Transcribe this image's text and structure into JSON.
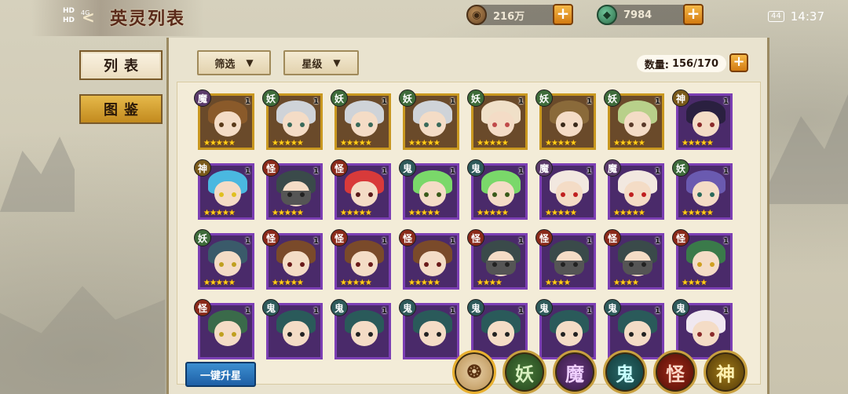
{
  "status_bar": {
    "left_labels": [
      "HD",
      "HD"
    ],
    "signal_text": "4G",
    "battery": "44",
    "time": "14:37"
  },
  "header": {
    "back_glyph": "<",
    "title": "英灵列表"
  },
  "resources": [
    {
      "name": "coin",
      "icon": "coin-icon",
      "value": "216万"
    },
    {
      "name": "jade",
      "icon": "jade-icon",
      "value": "7984"
    }
  ],
  "side_tabs": [
    {
      "label": "列表",
      "active": true
    },
    {
      "label": "图鉴",
      "active": false
    }
  ],
  "filters": [
    {
      "label": "筛选"
    },
    {
      "label": "星级"
    }
  ],
  "count": {
    "label": "数量:",
    "value": "156/170"
  },
  "plus_glyph": "+",
  "caret_glyph": "▼",
  "cards": [
    {
      "type": "魔",
      "level": "1",
      "frame": "gold",
      "stars": "★★★★★",
      "hair": "#8a5a2a",
      "eyes": "#5a3a1a"
    },
    {
      "type": "妖",
      "level": "1",
      "frame": "gold",
      "stars": "★★★★★",
      "hair": "#cfd3d8",
      "eyes": "#3a6a5a"
    },
    {
      "type": "妖",
      "level": "1",
      "frame": "gold",
      "stars": "★★★★★",
      "hair": "#cfd3d8",
      "eyes": "#3a6a5a"
    },
    {
      "type": "妖",
      "level": "1",
      "frame": "gold",
      "stars": "★★★★★",
      "hair": "#cfd3d8",
      "eyes": "#3a6a5a"
    },
    {
      "type": "妖",
      "level": "1",
      "frame": "gold",
      "stars": "★★★★★",
      "hair": "#f0e0c8",
      "eyes": "#c04a4a"
    },
    {
      "type": "妖",
      "level": "1",
      "frame": "gold",
      "stars": "★★★★★",
      "hair": "#8a6a3a",
      "eyes": "#3a2a1a"
    },
    {
      "type": "妖",
      "level": "1",
      "frame": "gold",
      "stars": "★★★★★",
      "hair": "#b8d08a",
      "eyes": "#5a3a2a"
    },
    {
      "type": "神",
      "level": "1",
      "frame": "purple",
      "stars": "★★★★★",
      "hair": "#2a2040",
      "eyes": "#8a2a2a"
    },
    {
      "type": "神",
      "level": "1",
      "frame": "purple",
      "stars": "★★★★★",
      "hair": "#4ab8e0",
      "eyes": "#e0c020"
    },
    {
      "type": "怪",
      "level": "1",
      "frame": "purple",
      "stars": "★★★★★",
      "hair": "#3a4a4a",
      "eyes": "#222",
      "mask": true
    },
    {
      "type": "怪",
      "level": "1",
      "frame": "purple",
      "stars": "★★★★★",
      "hair": "#d83a3a",
      "eyes": "#5a1a1a"
    },
    {
      "type": "鬼",
      "level": "1",
      "frame": "purple",
      "stars": "★★★★★",
      "hair": "#7ad86a",
      "eyes": "#3a5a1a"
    },
    {
      "type": "鬼",
      "level": "1",
      "frame": "purple",
      "stars": "★★★★★",
      "hair": "#7ad86a",
      "eyes": "#3a5a1a"
    },
    {
      "type": "魔",
      "level": "1",
      "frame": "purple",
      "stars": "★★★★★",
      "hair": "#f2e8e0",
      "eyes": "#c02020"
    },
    {
      "type": "魔",
      "level": "1",
      "frame": "purple",
      "stars": "★★★★★",
      "hair": "#f2e8e0",
      "eyes": "#c02020"
    },
    {
      "type": "妖",
      "level": "1",
      "frame": "purple",
      "stars": "★★★★★",
      "hair": "#6a5ab0",
      "eyes": "#2a6a5a"
    },
    {
      "type": "妖",
      "level": "1",
      "frame": "purple",
      "stars": "★★★★★",
      "hair": "#3a5a6a",
      "eyes": "#c0a020"
    },
    {
      "type": "怪",
      "level": "1",
      "frame": "purple",
      "stars": "★★★★★",
      "hair": "#7a4a2a",
      "eyes": "#6a1a1a"
    },
    {
      "type": "怪",
      "level": "1",
      "frame": "purple",
      "stars": "★★★★★",
      "hair": "#7a4a2a",
      "eyes": "#6a1a1a"
    },
    {
      "type": "怪",
      "level": "1",
      "frame": "purple",
      "stars": "★★★★★",
      "hair": "#7a4a2a",
      "eyes": "#6a1a1a"
    },
    {
      "type": "怪",
      "level": "1",
      "frame": "purple",
      "stars": "★★★★",
      "hair": "#3a4a4a",
      "eyes": "#222",
      "mask": true
    },
    {
      "type": "怪",
      "level": "1",
      "frame": "purple",
      "stars": "★★★★",
      "hair": "#3a4a4a",
      "eyes": "#222",
      "mask": true
    },
    {
      "type": "怪",
      "level": "1",
      "frame": "purple",
      "stars": "★★★★",
      "hair": "#3a4a4a",
      "eyes": "#222",
      "mask": true
    },
    {
      "type": "怪",
      "level": "1",
      "frame": "purple",
      "stars": "★★★★",
      "hair": "#3a7a4a",
      "eyes": "#d0a020"
    },
    {
      "type": "怪",
      "level": "1",
      "frame": "purple",
      "stars": "",
      "hair": "#3a6a4a",
      "eyes": "#c0a020"
    },
    {
      "type": "鬼",
      "level": "1",
      "frame": "purple",
      "stars": "",
      "hair": "#2a5a5a",
      "eyes": "#222"
    },
    {
      "type": "鬼",
      "level": "1",
      "frame": "purple",
      "stars": "",
      "hair": "#2a5a5a",
      "eyes": "#222"
    },
    {
      "type": "鬼",
      "level": "1",
      "frame": "purple",
      "stars": "",
      "hair": "#2a5a5a",
      "eyes": "#222"
    },
    {
      "type": "鬼",
      "level": "1",
      "frame": "purple",
      "stars": "",
      "hair": "#2a5a5a",
      "eyes": "#222"
    },
    {
      "type": "鬼",
      "level": "1",
      "frame": "purple",
      "stars": "",
      "hair": "#2a5a5a",
      "eyes": "#222"
    },
    {
      "type": "鬼",
      "level": "1",
      "frame": "purple",
      "stars": "",
      "hair": "#2a5a5a",
      "eyes": "#222"
    },
    {
      "type": "鬼",
      "level": "1",
      "frame": "purple",
      "stars": "",
      "hair": "#f0e8f0",
      "eyes": "#8a2a2a"
    }
  ],
  "upgrade_button": "一键升星",
  "categories": [
    {
      "key": "all",
      "label": "",
      "icon": "all-types-icon"
    },
    {
      "key": "yao",
      "label": "妖"
    },
    {
      "key": "mo",
      "label": "魔"
    },
    {
      "key": "gui",
      "label": "鬼"
    },
    {
      "key": "guai",
      "label": "怪"
    },
    {
      "key": "shen",
      "label": "神"
    }
  ]
}
